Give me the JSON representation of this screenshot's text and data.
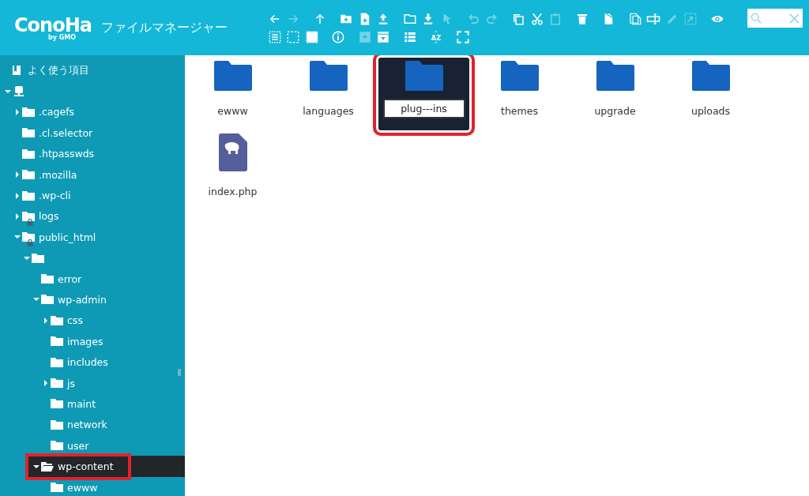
{
  "header": {
    "logo": {
      "text": "ConoHa",
      "sub": "by GMO"
    },
    "title": "ファイルマネージャー"
  },
  "toolbar": {
    "rows": [
      {
        "groups": [
          [
            {
              "kind": "back",
              "disabled": false
            },
            {
              "kind": "forward",
              "disabled": true
            }
          ],
          [
            {
              "kind": "up",
              "disabled": false
            }
          ],
          [
            {
              "kind": "mkdir",
              "disabled": false
            },
            {
              "kind": "mkfile",
              "disabled": false
            },
            {
              "kind": "upload",
              "disabled": false
            }
          ],
          [
            {
              "kind": "open",
              "disabled": false
            },
            {
              "kind": "download",
              "disabled": false
            },
            {
              "kind": "pointer",
              "disabled": true
            }
          ],
          [
            {
              "kind": "undo",
              "disabled": true
            },
            {
              "kind": "redo",
              "disabled": true
            }
          ],
          [
            {
              "kind": "copy",
              "disabled": false
            },
            {
              "kind": "cut",
              "disabled": false
            },
            {
              "kind": "paste",
              "disabled": true
            }
          ],
          [
            {
              "kind": "delete",
              "disabled": false
            }
          ],
          [
            {
              "kind": "empty",
              "disabled": false
            }
          ],
          [
            {
              "kind": "duplicate",
              "disabled": false
            },
            {
              "kind": "rename",
              "disabled": false
            },
            {
              "kind": "edit",
              "disabled": true
            },
            {
              "kind": "resize",
              "disabled": true
            }
          ],
          [
            {
              "kind": "view",
              "disabled": false
            }
          ]
        ]
      },
      {
        "groups": [
          [
            {
              "kind": "selectall",
              "disabled": false
            },
            {
              "kind": "selectnone",
              "disabled": false
            },
            {
              "kind": "selectinvert",
              "disabled": false
            }
          ],
          [
            {
              "kind": "info",
              "disabled": false
            }
          ],
          [
            {
              "kind": "extract",
              "disabled": true
            },
            {
              "kind": "archive",
              "disabled": false
            }
          ],
          [
            {
              "kind": "list",
              "disabled": false
            }
          ],
          [
            {
              "kind": "sort",
              "disabled": false,
              "label": "AZ"
            }
          ],
          [
            {
              "kind": "fullscreen",
              "disabled": false
            }
          ]
        ]
      }
    ]
  },
  "sidebar": {
    "favorites": {
      "label": "よく使う項目"
    },
    "tree": [
      {
        "kind": "computer",
        "expandable": true,
        "expanded": true,
        "selected": false,
        "children": [
          {
            "label": ".cagefs",
            "kind": "folder",
            "expandable": true,
            "expanded": false,
            "selected": false
          },
          {
            "label": ".cl.selector",
            "kind": "folder",
            "expandable": false,
            "selected": false
          },
          {
            "label": ".htpasswds",
            "kind": "folder",
            "expandable": false,
            "selected": false
          },
          {
            "label": ".mozilla",
            "kind": "folder",
            "expandable": true,
            "expanded": false,
            "selected": false
          },
          {
            "label": ".wp-cli",
            "kind": "folder",
            "expandable": true,
            "expanded": false,
            "selected": false
          },
          {
            "label": "logs",
            "kind": "folder",
            "expandable": true,
            "expanded": false,
            "locked": true,
            "selected": false
          },
          {
            "label": "public_html",
            "kind": "folder",
            "expandable": true,
            "expanded": true,
            "locked": true,
            "selected": false,
            "children": [
              {
                "kind": "folder",
                "expandable": true,
                "expanded": true,
                "selected": false,
                "children": [
                  {
                    "label": "error",
                    "kind": "folder",
                    "expandable": false,
                    "selected": false
                  },
                  {
                    "label": "wp-admin",
                    "kind": "folder",
                    "expandable": true,
                    "expanded": true,
                    "selected": false,
                    "children": [
                      {
                        "label": "css",
                        "kind": "folder",
                        "expandable": true,
                        "expanded": false,
                        "selected": false
                      },
                      {
                        "label": "images",
                        "kind": "folder",
                        "expandable": false,
                        "selected": false
                      },
                      {
                        "label": "includes",
                        "kind": "folder",
                        "expandable": false,
                        "selected": false
                      },
                      {
                        "label": "js",
                        "kind": "folder",
                        "expandable": true,
                        "expanded": false,
                        "selected": false
                      },
                      {
                        "label": "maint",
                        "kind": "folder",
                        "expandable": false,
                        "selected": false
                      },
                      {
                        "label": "network",
                        "kind": "folder",
                        "expandable": false,
                        "selected": false
                      },
                      {
                        "label": "user",
                        "kind": "folder",
                        "expandable": false,
                        "selected": false
                      }
                    ]
                  },
                  {
                    "label": "wp-content",
                    "kind": "folder",
                    "expandable": true,
                    "expanded": true,
                    "selected": true,
                    "highlighted": true,
                    "children": [
                      {
                        "label": "ewww",
                        "kind": "folder",
                        "expandable": false,
                        "selected": false
                      }
                    ]
                  }
                ]
              }
            ]
          }
        ]
      }
    ]
  },
  "files": [
    {
      "name": "ewww",
      "kind": "folder",
      "selected": false,
      "renaming": false,
      "highlighted": false
    },
    {
      "name": "languages",
      "kind": "folder",
      "selected": false,
      "renaming": false,
      "highlighted": false
    },
    {
      "name": "plug---ins",
      "kind": "folder",
      "selected": true,
      "renaming": true,
      "highlighted": true
    },
    {
      "name": "themes",
      "kind": "folder",
      "selected": false,
      "renaming": false,
      "highlighted": false
    },
    {
      "name": "upgrade",
      "kind": "folder",
      "selected": false,
      "renaming": false,
      "highlighted": false
    },
    {
      "name": "uploads",
      "kind": "folder",
      "selected": false,
      "renaming": false,
      "highlighted": false
    },
    {
      "name": "index.php",
      "kind": "php",
      "selected": false,
      "renaming": false,
      "highlighted": false
    }
  ]
}
